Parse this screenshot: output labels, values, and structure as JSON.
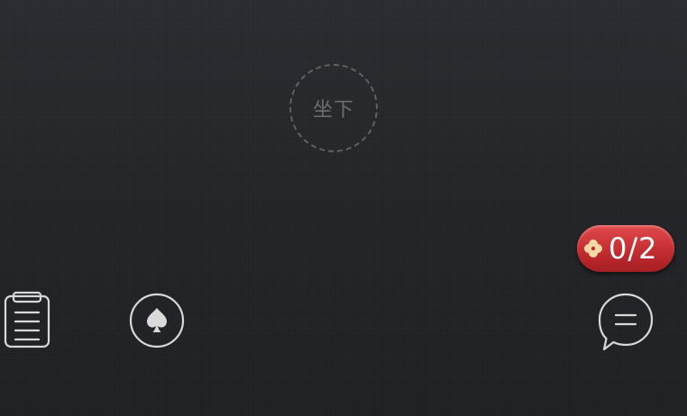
{
  "seat": {
    "label": "坐下"
  },
  "counter": {
    "value": "0/2"
  },
  "icons": {
    "left_button": "clipboard-icon",
    "center_button": "spade-icon",
    "right_button": "chat-bubble-icon",
    "counter_icon": "clover-icon"
  },
  "colors": {
    "background": "#252629",
    "badge": "#c42d31",
    "clover": "#f3d9a6",
    "icon_stroke": "#d8d8d8"
  }
}
